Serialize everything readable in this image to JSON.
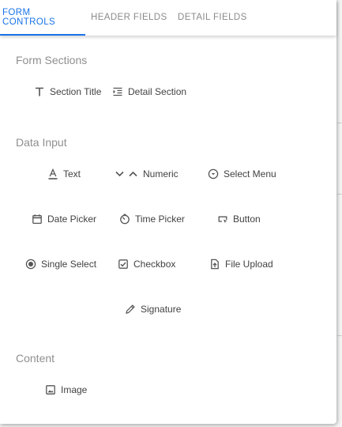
{
  "tabs": [
    {
      "label": "FORM CONTROLS"
    },
    {
      "label": "HEADER FIELDS"
    },
    {
      "label": "DETAIL FIELDS"
    }
  ],
  "sections": {
    "form_sections": {
      "title": "Form Sections",
      "items": [
        {
          "label": "Section Title",
          "icon": "text-t-icon"
        },
        {
          "label": "Detail Section",
          "icon": "indent-list-icon"
        }
      ]
    },
    "data_input": {
      "title": "Data Input",
      "items": [
        {
          "label": "Text",
          "icon": "underlined-a-icon"
        },
        {
          "label": "Numeric",
          "icon": "chevron-up-down-icon"
        },
        {
          "label": "Select Menu",
          "icon": "circle-dropdown-icon"
        },
        {
          "label": "Date Picker",
          "icon": "calendar-icon"
        },
        {
          "label": "Time Picker",
          "icon": "timer-icon"
        },
        {
          "label": "Button",
          "icon": "button-cursor-icon"
        },
        {
          "label": "Single Select",
          "icon": "radio-button-icon"
        },
        {
          "label": "Checkbox",
          "icon": "checkbox-icon"
        },
        {
          "label": "File Upload",
          "icon": "file-upload-icon"
        },
        {
          "label": "Signature",
          "icon": "pencil-icon"
        }
      ]
    },
    "content": {
      "title": "Content",
      "items": [
        {
          "label": "Image",
          "icon": "image-icon"
        }
      ]
    }
  },
  "colors": {
    "accent": "#1a73e8",
    "section_title": "#8f8f8f",
    "text": "#424242"
  }
}
